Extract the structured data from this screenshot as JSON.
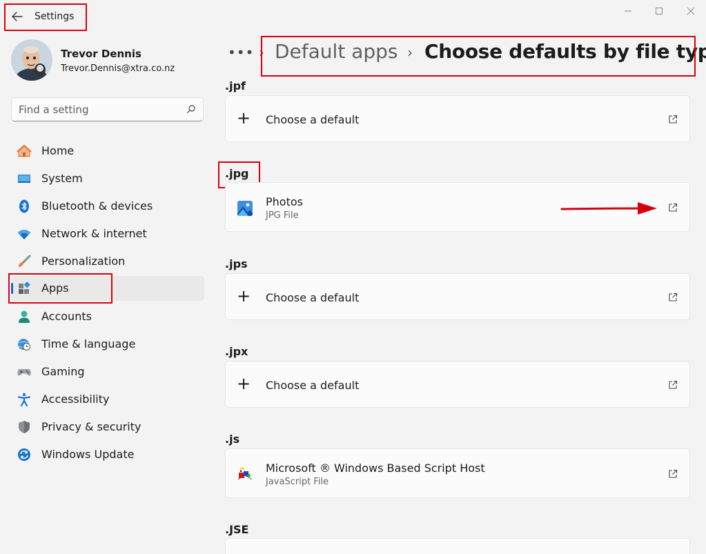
{
  "window": {
    "title": "Settings",
    "controls": {
      "minimize": "—",
      "maximize": "☐",
      "close": "✕"
    }
  },
  "profile": {
    "name": "Trevor Dennis",
    "email": "Trevor.Dennis@xtra.co.nz"
  },
  "search": {
    "placeholder": "Find a setting"
  },
  "nav": {
    "items": [
      {
        "label": "Home",
        "icon": "home-icon"
      },
      {
        "label": "System",
        "icon": "system-icon"
      },
      {
        "label": "Bluetooth & devices",
        "icon": "bluetooth-icon"
      },
      {
        "label": "Network & internet",
        "icon": "wifi-icon"
      },
      {
        "label": "Personalization",
        "icon": "brush-icon"
      },
      {
        "label": "Apps",
        "icon": "apps-icon",
        "selected": true
      },
      {
        "label": "Accounts",
        "icon": "person-icon"
      },
      {
        "label": "Time & language",
        "icon": "globe-clock-icon"
      },
      {
        "label": "Gaming",
        "icon": "gamepad-icon"
      },
      {
        "label": "Accessibility",
        "icon": "accessibility-icon"
      },
      {
        "label": "Privacy & security",
        "icon": "shield-icon"
      },
      {
        "label": "Windows Update",
        "icon": "update-icon"
      }
    ]
  },
  "breadcrumb": {
    "overflow": "•••",
    "separator": "›",
    "parent": "Default apps",
    "current": "Choose defaults by file type"
  },
  "file_types": [
    {
      "ext": ".jpf",
      "type": "choose",
      "label": "Choose a default"
    },
    {
      "ext": ".jpg",
      "type": "app",
      "app_name": "Photos",
      "description": "JPG File",
      "icon": "photos-icon"
    },
    {
      "ext": ".jps",
      "type": "choose",
      "label": "Choose a default"
    },
    {
      "ext": ".jpx",
      "type": "choose",
      "label": "Choose a default"
    },
    {
      "ext": ".js",
      "type": "app",
      "app_name": "Microsoft ® Windows Based Script Host",
      "description": "JavaScript File",
      "icon": "script-host-icon"
    },
    {
      "ext": ".JSE",
      "type": "partial"
    }
  ],
  "colors": {
    "accent": "#1a63c4",
    "annotation": "#d8000c",
    "background": "#f3f3f3",
    "card": "#fbfbfb"
  }
}
